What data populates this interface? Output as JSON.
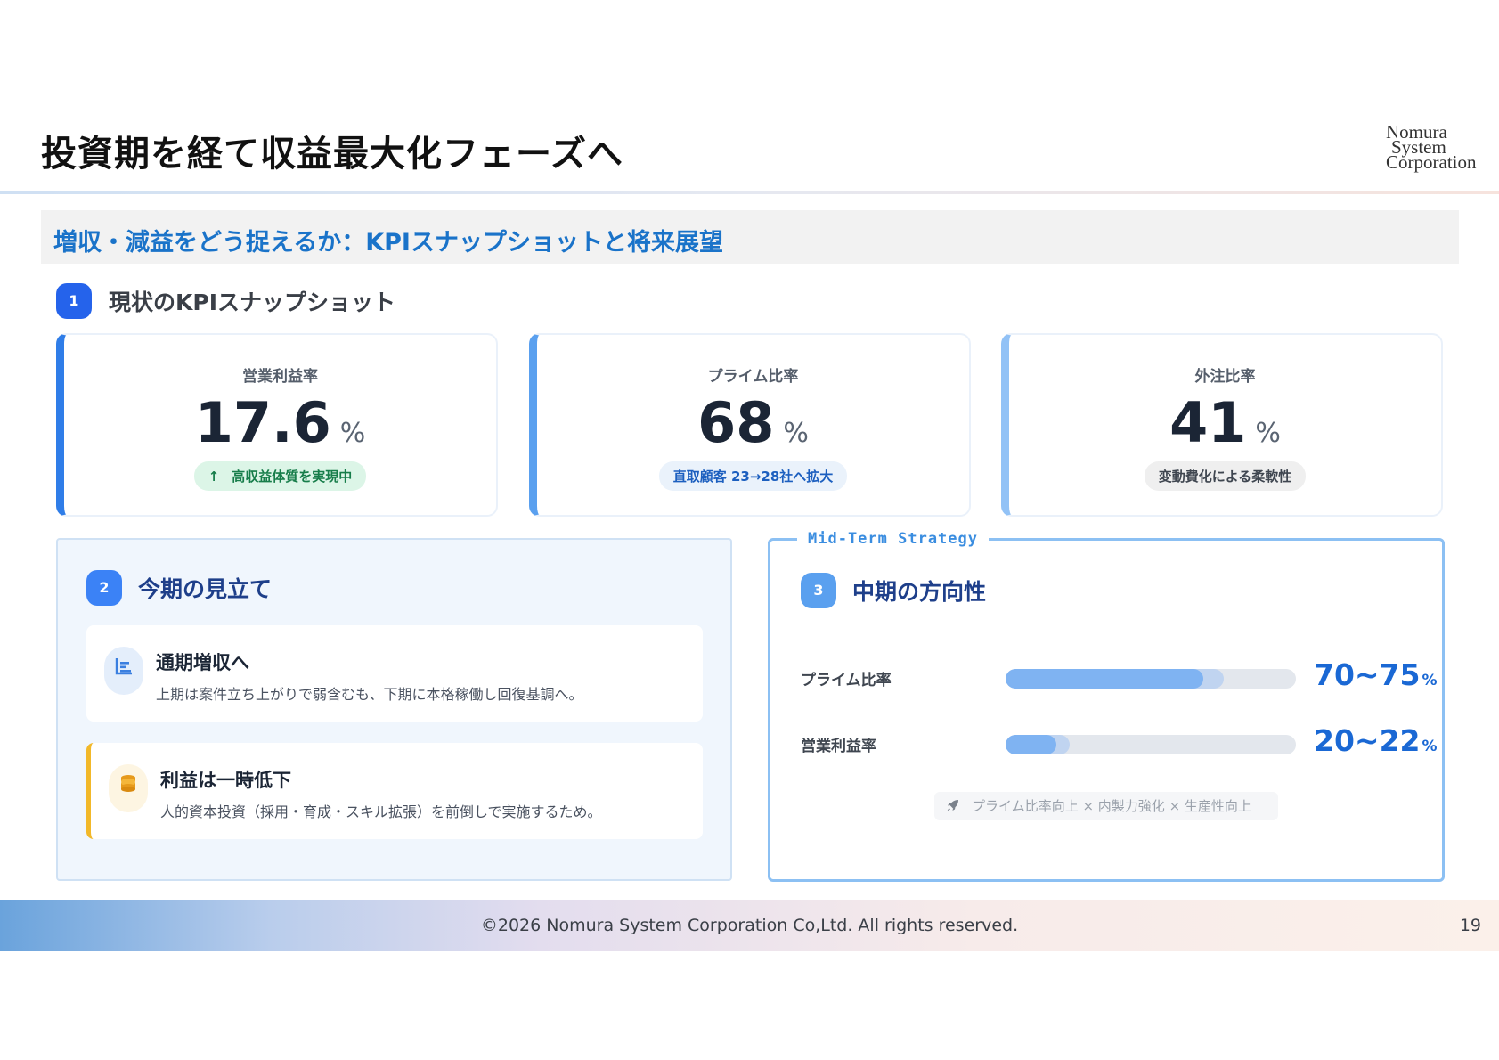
{
  "slide": {
    "title": "投資期を経て収益最大化フェーズへ",
    "logo": {
      "line1": "Nomura",
      "line2": "System",
      "line3": "Corporation"
    },
    "subtitle": "増収・減益をどう捉えるか：KPIスナップショットと将来展望"
  },
  "section1": {
    "number": "1",
    "heading": "現状のKPIスナップショット",
    "kpis": [
      {
        "label": "営業利益率",
        "value": "17.6",
        "unit": "%",
        "note_icon": "↑",
        "note": "高収益体質を実現中",
        "note_icon_name": "arrow-up-icon"
      },
      {
        "label": "プライム比率",
        "value": "68",
        "unit": "%",
        "note": "直取顧客 23→28社へ拡大"
      },
      {
        "label": "外注比率",
        "value": "41",
        "unit": "%",
        "note": "変動費化による柔軟性"
      }
    ]
  },
  "section2": {
    "number": "2",
    "heading": "今期の見立て",
    "items": [
      {
        "icon": "chart-bars-icon",
        "title": "通期増収へ",
        "desc": "上期は案件立ち上がりで弱含むも、下期に本格稼働し回復基調へ。"
      },
      {
        "icon": "coins-icon",
        "title": "利益は一時低下",
        "desc": "人的資本投資（採用・育成・スキル拡張）を前倒しで実施するため。"
      }
    ]
  },
  "section3": {
    "tag": "Mid-Term Strategy",
    "number": "3",
    "heading": "中期の方向性",
    "bars": [
      {
        "label": "プライム比率",
        "value_text": "70~75",
        "unit": "%",
        "current": 68,
        "target_min": 70,
        "target_max": 75,
        "scale_max": 100
      },
      {
        "label": "営業利益率",
        "value_text": "20~22",
        "unit": "%",
        "current": 17.6,
        "target_min": 20,
        "target_max": 22,
        "scale_max": 100
      }
    ],
    "note_icon": "rocket-icon",
    "note": "プライム比率向上 × 内製力強化 × 生産性向上"
  },
  "footer": {
    "copyright": "©2026 Nomura System Corporation Co,Ltd. All rights reserved.",
    "page": "19"
  },
  "colors": {
    "accent": "#1a73c9",
    "badge_dark": "#2563eb",
    "badge_mid": "#3b82f6",
    "badge_light": "#5aa0ef",
    "warn": "#f2b829"
  }
}
